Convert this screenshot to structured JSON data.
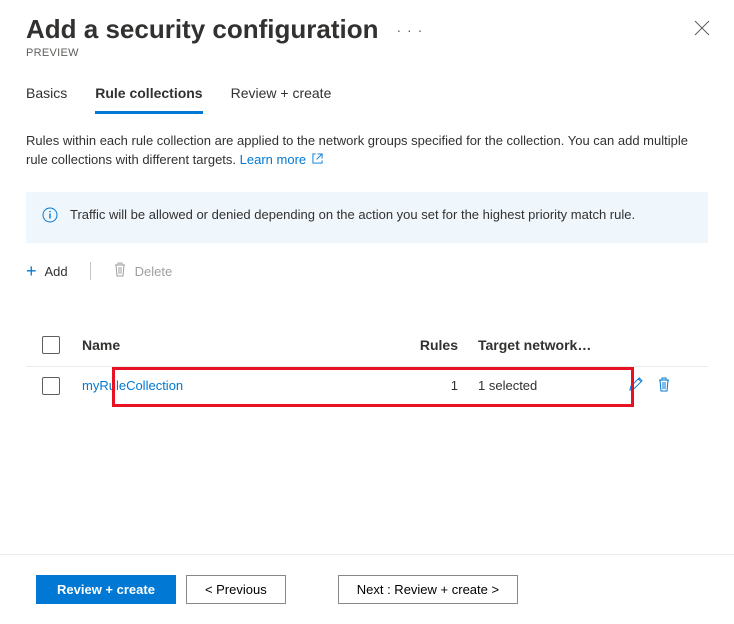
{
  "header": {
    "title": "Add a security configuration",
    "subtitle": "PREVIEW"
  },
  "tabs": {
    "basics": "Basics",
    "rule_collections": "Rule collections",
    "review_create": "Review + create",
    "active": "rule_collections"
  },
  "description": {
    "text": "Rules within each rule collection are applied to the network groups specified for the collection. You can add multiple rule collections with different targets. ",
    "learn_more": "Learn more"
  },
  "info": {
    "text": "Traffic will be allowed or denied depending on the action you set for the highest priority match rule."
  },
  "toolbar": {
    "add": "Add",
    "delete": "Delete"
  },
  "table": {
    "headers": {
      "name": "Name",
      "rules": "Rules",
      "target": "Target network…"
    },
    "rows": [
      {
        "name": "myRuleCollection",
        "rules": "1",
        "target": "1 selected"
      }
    ]
  },
  "footer": {
    "review_create": "Review + create",
    "previous": "< Previous",
    "next": "Next : Review + create >"
  }
}
